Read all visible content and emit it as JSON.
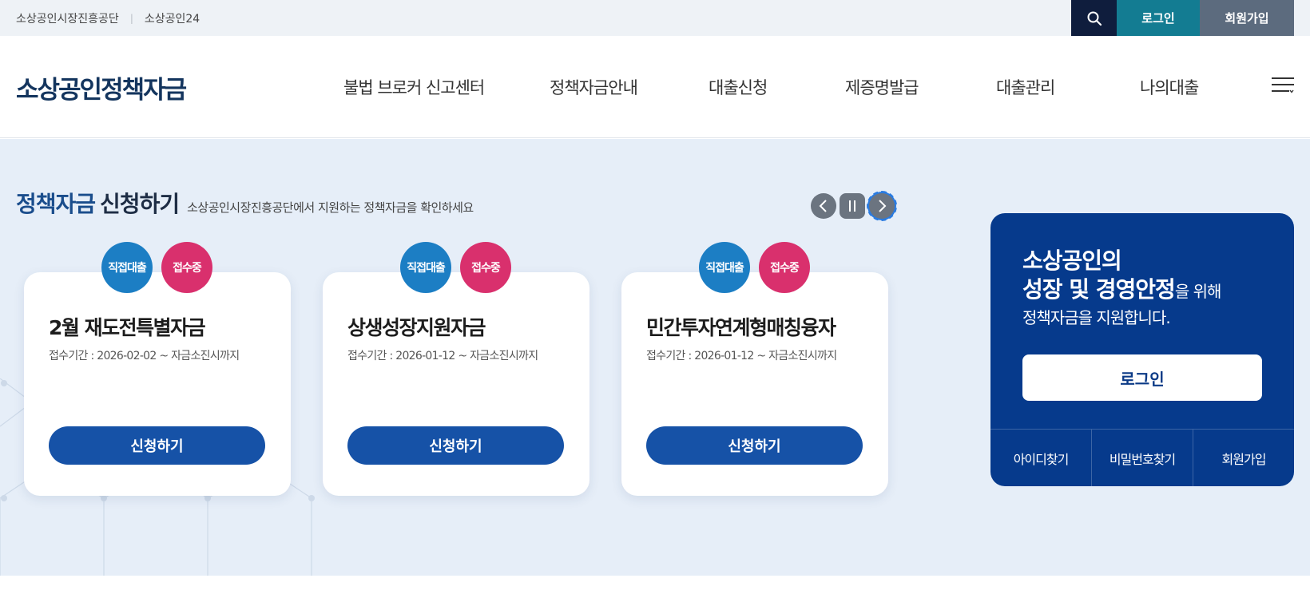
{
  "topbar": {
    "links": [
      "소상공인시장진흥공단",
      "소상공인24"
    ],
    "login": "로그인",
    "join": "회원가입"
  },
  "header": {
    "logo": "소상공인정책자금",
    "nav": [
      "불법 브로커 신고센터",
      "정책자금안내",
      "대출신청",
      "제증명발급",
      "대출관리",
      "나의대출"
    ]
  },
  "section": {
    "title_highlight": "정책자금",
    "title_rest": "신청하기",
    "description": "소상공인시장진흥공단에서 지원하는 정책자금을 확인하세요"
  },
  "cards": [
    {
      "badge1": "직접대출",
      "badge2": "접수중",
      "title": "2월 재도전특별자금",
      "period": "접수기간 : 2026-02-02 ~ 자금소진시까지",
      "button": "신청하기"
    },
    {
      "badge1": "직접대출",
      "badge2": "접수중",
      "title": "상생성장지원자금",
      "period": "접수기간 : 2026-01-12 ~ 자금소진시까지",
      "button": "신청하기"
    },
    {
      "badge1": "직접대출",
      "badge2": "접수중",
      "title": "민간투자연계형매칭융자",
      "period": "접수기간 : 2026-01-12 ~ 자금소진시까지",
      "button": "신청하기"
    }
  ],
  "login_box": {
    "line1": "소상공인의",
    "line2_bold": "성장 및 경영안정",
    "line2_small": "을 위해",
    "line3": "정책자금을 지원합니다.",
    "login_button": "로그인",
    "links": [
      "아이디찾기",
      "비밀번호찾기",
      "회원가입"
    ]
  },
  "colors": {
    "topbar_bg": "#eef2f6",
    "search_bg": "#0f1d3d",
    "login_bg": "#137c92",
    "join_bg": "#5c6b7e",
    "main_bg": "#e6eef8",
    "badge_blue": "#1c7ec4",
    "badge_pink": "#d9306d",
    "apply_button": "#1652a7",
    "login_panel": "#063a8c"
  },
  "icons": {
    "search": "search-icon",
    "menu": "hamburger-menu-icon",
    "prev": "chevron-left-icon",
    "pause": "pause-icon",
    "next": "chevron-right-icon"
  }
}
